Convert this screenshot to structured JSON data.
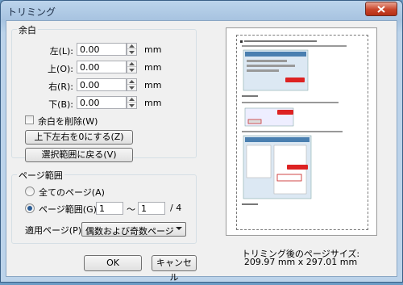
{
  "window": {
    "title": "トリミング"
  },
  "margin_group": {
    "title": "余白",
    "fields": [
      {
        "label": "左(L):",
        "value": "0.00",
        "unit": "mm"
      },
      {
        "label": "上(O):",
        "value": "0.00",
        "unit": "mm"
      },
      {
        "label": "右(R):",
        "value": "0.00",
        "unit": "mm"
      },
      {
        "label": "下(B):",
        "value": "0.00",
        "unit": "mm"
      }
    ],
    "remove_margin_checkbox": {
      "label": "余白を削除(W)",
      "checked": false
    },
    "zero_button": "上下左右を0にする(Z)",
    "restore_button": "選択範囲に戻る(V)"
  },
  "page_range_group": {
    "title": "ページ範囲",
    "all_pages": {
      "label": "全てのページ(A)",
      "selected": false
    },
    "page_range": {
      "label": "ページ範囲(G)",
      "selected": true,
      "from": "1",
      "separator": "〜",
      "to": "1",
      "total": "/ 4"
    },
    "apply_label": "適用ページ(P):",
    "apply_value": "偶数および奇数ページ"
  },
  "buttons": {
    "ok": "OK",
    "cancel": "キャンセル"
  },
  "preview": {
    "size_label": "トリミング後のページサイズ:",
    "size_value": "209.97 mm x 297.01 mm"
  }
}
